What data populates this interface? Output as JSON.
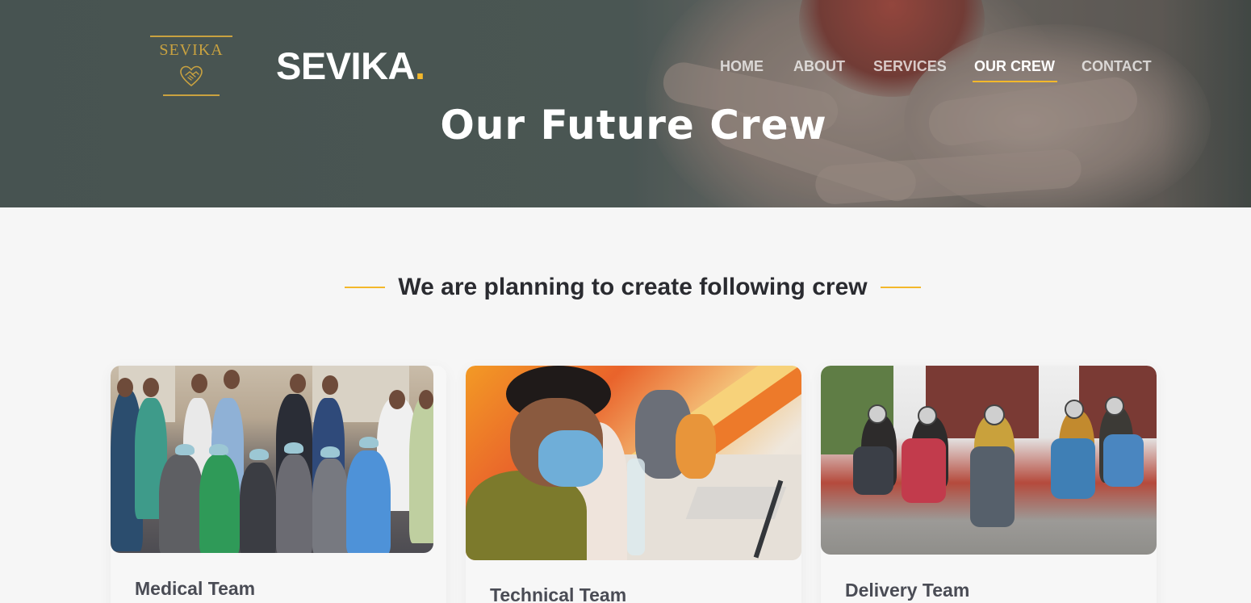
{
  "header": {
    "logo_word": "SEVIKA",
    "brand_name": "SEVIKA",
    "brand_dot": ".",
    "accent_color": "#f3b82b",
    "logo_color": "#c9a240",
    "nav": [
      {
        "label": "HOME",
        "active": false
      },
      {
        "label": "ABOUT",
        "active": false
      },
      {
        "label": "SERVICES",
        "active": false
      },
      {
        "label": "OUR CREW",
        "active": true
      },
      {
        "label": "CONTACT",
        "active": false
      }
    ]
  },
  "hero": {
    "title": "Our Future Crew"
  },
  "section": {
    "heading": "We are planning to create following crew"
  },
  "cards": [
    {
      "title": "Medical Team",
      "image_icon": "medical-team-photo"
    },
    {
      "title": "Technical Team",
      "image_icon": "technical-team-photo"
    },
    {
      "title": "Delivery Team",
      "image_icon": "delivery-team-photo"
    }
  ]
}
